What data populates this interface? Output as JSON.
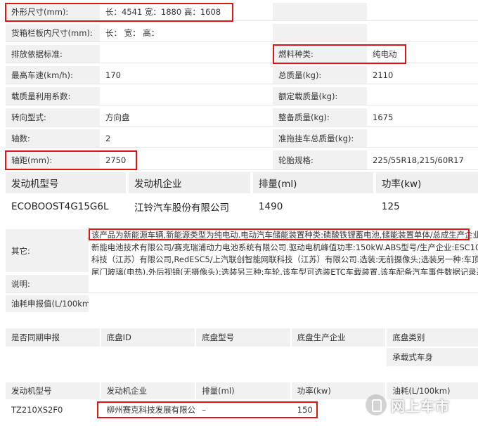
{
  "params": [
    {
      "l1": "外形尺寸(mm):",
      "v1": "长：4541 宽：1880 高：1608",
      "l2": "",
      "v2": ""
    },
    {
      "l1": "货箱栏板内尺寸(mm):",
      "v1": "长：   宽：   高：",
      "l2": "",
      "v2": ""
    },
    {
      "l1": "排放依据标准:",
      "v1": "",
      "l2": "燃料种类:",
      "v2": "纯电动"
    },
    {
      "l1": "最高车速(km/h):",
      "v1": "170",
      "l2": "总质量(kg):",
      "v2": "2110"
    },
    {
      "l1": "载质量利用系数:",
      "v1": "",
      "l2": "额定载质量(kg):",
      "v2": ""
    },
    {
      "l1": "转向型式:",
      "v1": "方向盘",
      "l2": "整备质量(kg):",
      "v2": "1675"
    },
    {
      "l1": "轴数:",
      "v1": "2",
      "l2": "准拖挂车总质量(kg):",
      "v2": ""
    },
    {
      "l1": "轴距(mm):",
      "v1": "2750",
      "l2": "轮胎规格:",
      "v2": "225/55R18,215/60R17"
    }
  ],
  "engine_main": {
    "headers": [
      "发动机型号",
      "发动机企业",
      "排量(ml)",
      "功率(kw)"
    ],
    "row": [
      "ECOBOOST4G15G6L",
      "江铃汽车股份有限公司",
      "1490",
      "125"
    ]
  },
  "other": {
    "label": "其它:",
    "lines": [
      "该产品为新能源车辆,新能源类型为纯电动.电动汽车储能装置种类:磷酸铁锂蓄电池,储能装置单体/总成生产企业:江苏正力",
      "新能电池技术有限公司/赛克瑞浦动力电池系统有限公司.驱动电机峰值功率:150kW.ABS型号/生产企业:ESC10/中鼎汽车",
      "科技（江苏）有限公司,RedESC5/上汽联创智能网联科技（江苏）有限公司.选装:无前摄像头;选装另一种:车顶(车身同色)",
      "尾门玻璃(电热),外后视镜(无摄像头);选装另三种:车轮.该车型可选装ETC车载装置,该车配备汽车事件数据记录系统(EDR)."
    ]
  },
  "notes_row": {
    "label": "说明:",
    "value": ""
  },
  "fuel_row": {
    "label": "油耗申报值(L/100km):",
    "value": ""
  },
  "chassis": {
    "headers": [
      "是否同期申报",
      "底盘ID",
      "底盘型号",
      "底盘生产企业",
      "底盘类别"
    ],
    "row": [
      "",
      "",
      "",
      "",
      "承载式车身"
    ]
  },
  "engine2": {
    "headers": [
      "发动机型号",
      "发动机企业",
      "排量(ml)",
      "功率(kw)",
      "油耗(L/100km)"
    ],
    "row": [
      "TZ210XS2F0",
      "柳州赛克科技发展有限公司",
      "–",
      "150",
      ""
    ]
  },
  "watermark": {
    "text": "网上车市",
    "icon": "car-site-logo-icon"
  },
  "colors": {
    "highlight": "#e01414",
    "label_bg": "#f1f1f1"
  }
}
